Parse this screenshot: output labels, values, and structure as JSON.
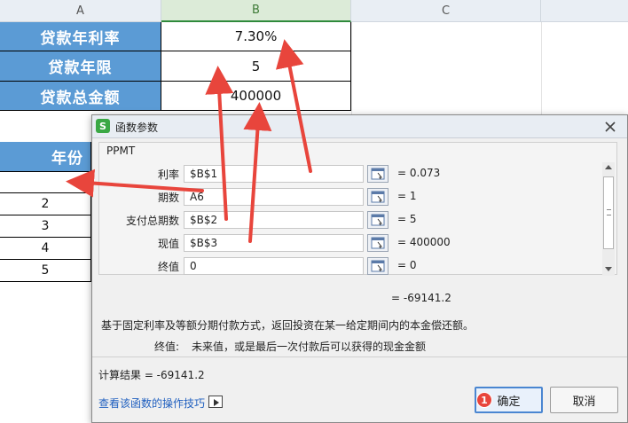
{
  "sheet": {
    "columns": [
      "A",
      "B",
      "C"
    ],
    "params": [
      {
        "label": "贷款年利率",
        "value": "7.30%"
      },
      {
        "label": "贷款年限",
        "value": "5"
      },
      {
        "label": "贷款总金额",
        "value": "400000"
      }
    ],
    "year_header": "年份",
    "years": [
      "",
      "2",
      "3",
      "4",
      "5"
    ]
  },
  "dialog": {
    "title": "函数参数",
    "function_name": "PPMT",
    "args": [
      {
        "label": "利率",
        "value": "$B$1",
        "result": "= 0.073"
      },
      {
        "label": "期数",
        "value": "A6",
        "result": "= 1"
      },
      {
        "label": "支付总期数",
        "value": "$B$2",
        "result": "= 5"
      },
      {
        "label": "现值",
        "value": "$B$3",
        "result": "= 400000"
      },
      {
        "label": "终值",
        "value": "0",
        "result": "= 0"
      }
    ],
    "formula_result": "=   -69141.2",
    "description": "基于固定利率及等额分期付款方式，返回投资在某一给定期间内的本金偿还额。",
    "arg_help_label": "终值:",
    "arg_help_text": "未来值，或是最后一次付款后可以获得的现金金额",
    "calc_result": "计算结果 =   -69141.2",
    "help_link": "查看该函数的操作技巧",
    "ok_label": "确定",
    "cancel_label": "取消",
    "step_badge": "1"
  },
  "colors": {
    "header_fill": "#5b9bd5",
    "arrow": "#e8453c",
    "link": "#1f5fbf"
  }
}
